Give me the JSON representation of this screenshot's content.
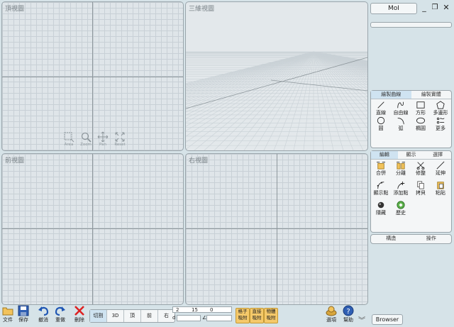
{
  "viewports": {
    "top": {
      "title": "頂視圖"
    },
    "3d": {
      "title": "三維視圖"
    },
    "front": {
      "title": "前視圖"
    },
    "right": {
      "title": "右視圖"
    }
  },
  "nav_tools": [
    {
      "label": "Area",
      "icon": "area-zoom-icon"
    },
    {
      "label": "Zoom",
      "icon": "zoom-icon"
    },
    {
      "label": "Pan",
      "icon": "pan-icon"
    },
    {
      "label": "Reset",
      "icon": "reset-icon"
    }
  ],
  "app": {
    "title": "MoI"
  },
  "draw_panel": {
    "tabs": [
      "繪製曲線",
      "繪製實體"
    ],
    "active_tab": 0,
    "tools": [
      {
        "label": "直線",
        "icon": "line-icon"
      },
      {
        "label": "自由線",
        "icon": "freeform-curve-icon"
      },
      {
        "label": "方形",
        "icon": "rectangle-icon"
      },
      {
        "label": "多邊形",
        "icon": "polygon-icon"
      },
      {
        "label": "圓",
        "icon": "circle-icon"
      },
      {
        "label": "弧",
        "icon": "arc-icon"
      },
      {
        "label": "橢圓",
        "icon": "ellipse-icon"
      },
      {
        "label": "更多",
        "icon": "more-icon"
      }
    ]
  },
  "edit_panel": {
    "tabs": [
      "編輯",
      "顯示",
      "選擇"
    ],
    "active_tab": 0,
    "tools": [
      {
        "label": "合併",
        "icon": "join-icon"
      },
      {
        "label": "分離",
        "icon": "separate-icon"
      },
      {
        "label": "修整",
        "icon": "trim-icon"
      },
      {
        "label": "延伸",
        "icon": "extend-icon"
      },
      {
        "label": "顯示點",
        "icon": "show-points-icon"
      },
      {
        "label": "添加點",
        "icon": "add-point-icon"
      },
      {
        "label": "拷貝",
        "icon": "copy-icon"
      },
      {
        "label": "粘貼",
        "icon": "paste-icon"
      },
      {
        "label": "隱藏",
        "icon": "hide-icon"
      },
      {
        "label": "歷史",
        "icon": "history-icon"
      }
    ]
  },
  "construct_panel": {
    "tabs": [
      "構造",
      "操作"
    ]
  },
  "bottom": {
    "file": "文件",
    "save": "保存",
    "undo": "撤消",
    "redo": "重做",
    "delete": "刪除",
    "views": [
      "切割",
      "3D",
      "頂",
      "前",
      "右"
    ],
    "active_view": 0,
    "coords": {
      "x": "2",
      "y": "15",
      "z": "0",
      "d_label": "d"
    },
    "snaps": [
      "格子吸附",
      "直接吸附",
      "物體吸附"
    ],
    "options": "選項",
    "help": "幫助",
    "browser": "Browser"
  }
}
